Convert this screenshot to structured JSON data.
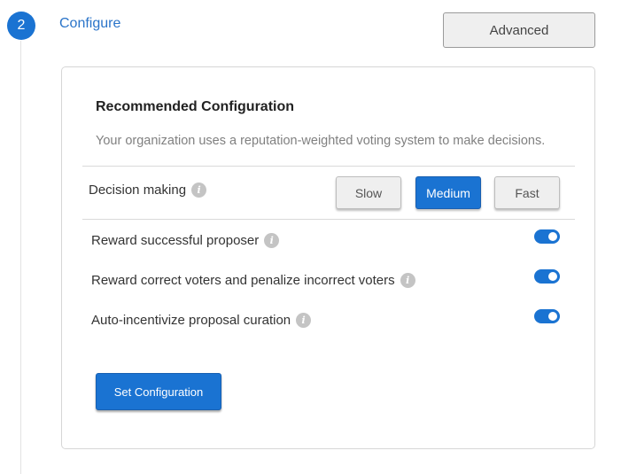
{
  "step": {
    "number": "2",
    "title": "Configure"
  },
  "header": {
    "advanced_label": "Advanced"
  },
  "card": {
    "title": "Recommended Configuration",
    "description": "Your organization uses a reputation-weighted voting system to make decisions.",
    "decision_making": {
      "label": "Decision making",
      "options": [
        "Slow",
        "Medium",
        "Fast"
      ],
      "selected": "Medium"
    },
    "toggles": [
      {
        "label": "Reward successful proposer",
        "on": true
      },
      {
        "label": "Reward correct voters and penalize incorrect voters",
        "on": true
      },
      {
        "label": "Auto-incentivize proposal curation",
        "on": true
      }
    ],
    "submit_label": "Set Configuration"
  },
  "colors": {
    "accent": "#1a73d2",
    "step_title": "#2a74c9",
    "info_icon": "#c4c4c4"
  }
}
